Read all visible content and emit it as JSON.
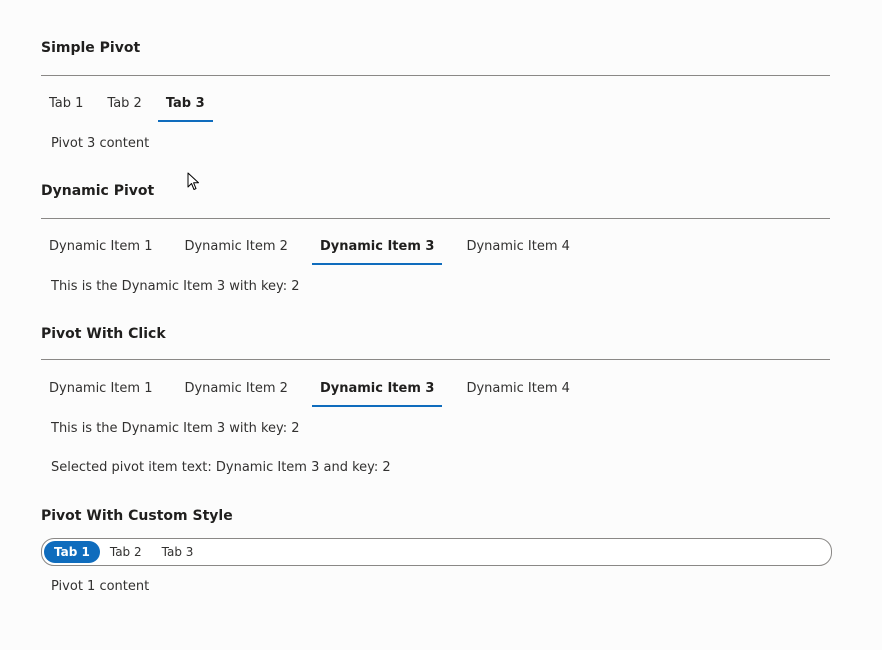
{
  "simple": {
    "title": "Simple Pivot",
    "tabs": [
      "Tab 1",
      "Tab 2",
      "Tab 3"
    ],
    "selected": 2,
    "content": "Pivot 3 content"
  },
  "dynamic": {
    "title": "Dynamic Pivot",
    "tabs": [
      "Dynamic Item 1",
      "Dynamic Item 2",
      "Dynamic Item 3",
      "Dynamic Item 4"
    ],
    "selected": 2,
    "content": "This is the Dynamic Item 3 with key: 2"
  },
  "click": {
    "title": "Pivot With Click",
    "tabs": [
      "Dynamic Item 1",
      "Dynamic Item 2",
      "Dynamic Item 3",
      "Dynamic Item 4"
    ],
    "selected": 2,
    "content": "This is the Dynamic Item 3 with key: 2",
    "selection_text": "Selected pivot item text: Dynamic Item 3 and key: 2"
  },
  "custom": {
    "title": "Pivot With Custom Style",
    "tabs": [
      "Tab 1",
      "Tab 2",
      "Tab 3"
    ],
    "selected": 0,
    "content": "Pivot 1 content"
  },
  "colors": {
    "accent": "#0f6cbd",
    "divider": "#8a8886",
    "text": "#323130"
  },
  "icons": {
    "cursor": "mouse-pointer-icon"
  }
}
